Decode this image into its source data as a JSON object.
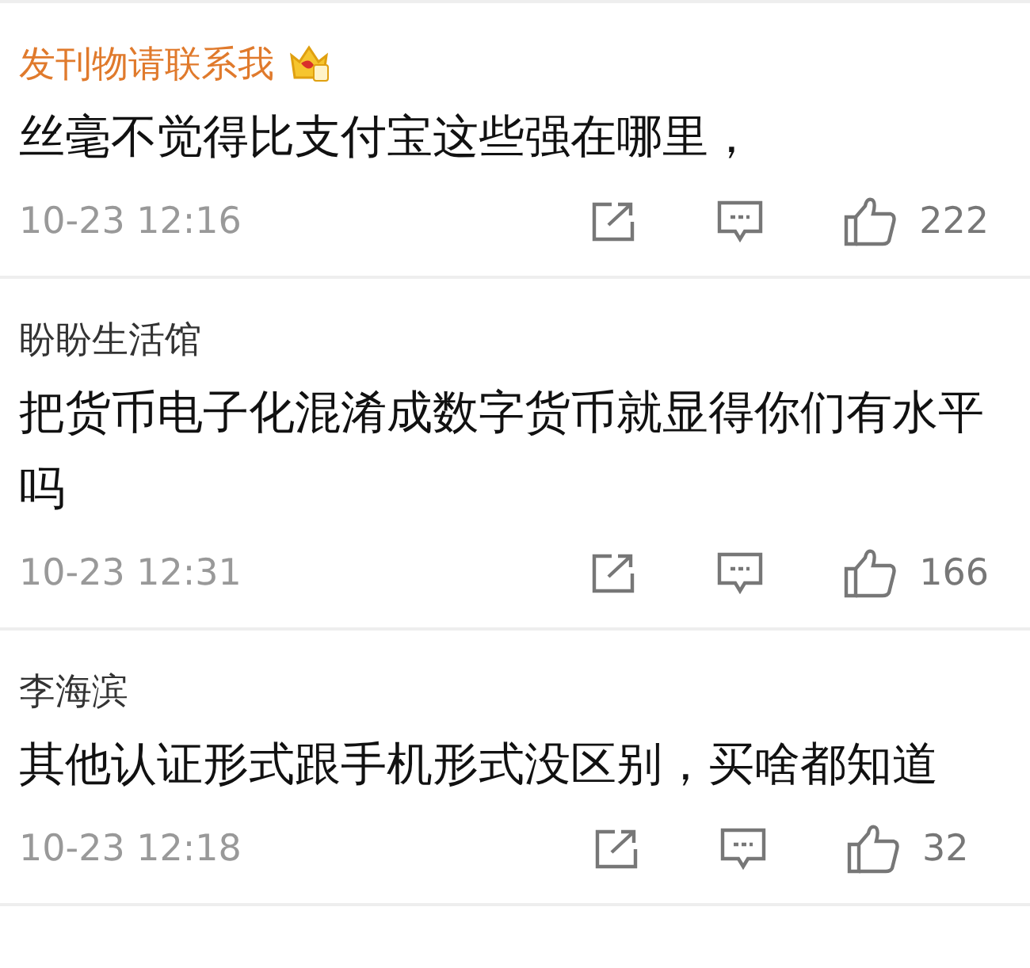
{
  "comments": [
    {
      "author": "发刊物请联系我",
      "vip": true,
      "text": "丝毫不觉得比支付宝这些强在哪里，",
      "time": "10-23 12:16",
      "likes": "222"
    },
    {
      "author": "盼盼生活馆",
      "vip": false,
      "text": "把货币电子化混淆成数字货币就显得你们有水平吗",
      "time": "10-23 12:31",
      "likes": "166"
    },
    {
      "author": "李海滨",
      "vip": false,
      "text": "其他认证形式跟手机形式没区别，买啥都知道",
      "time": "10-23 12:18",
      "likes": "32"
    }
  ]
}
